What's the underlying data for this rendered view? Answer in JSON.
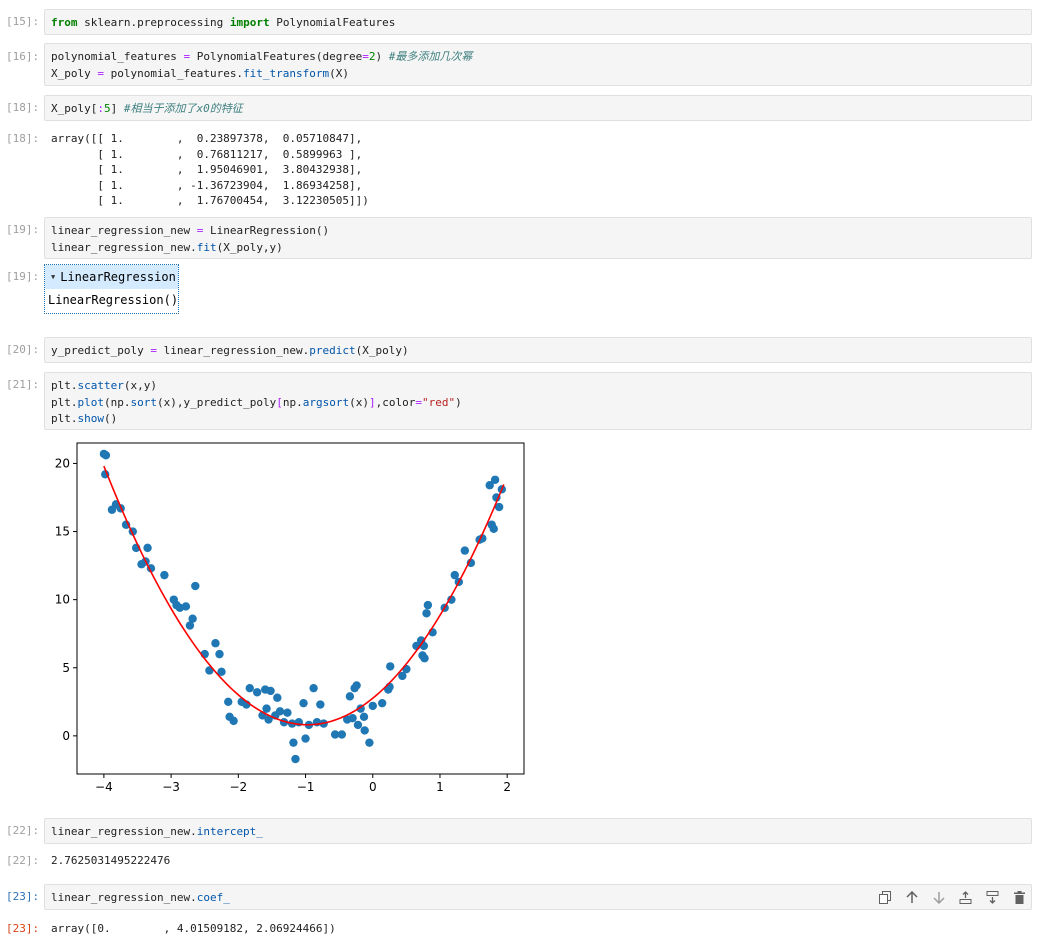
{
  "cells": {
    "c15": {
      "prompt": "[15]:"
    },
    "c16": {
      "prompt": "[16]:"
    },
    "c18": {
      "prompt": "[18]:",
      "out_prompt": "[18]:",
      "output": "array([[ 1.        ,  0.23897378,  0.05710847],\n       [ 1.        ,  0.76811217,  0.5899963 ],\n       [ 1.        ,  1.95046901,  3.80432938],\n       [ 1.        , -1.36723904,  1.86934258],\n       [ 1.        ,  1.76700454,  3.12230505]])"
    },
    "c19": {
      "prompt": "[19]:",
      "out_prompt": "[19]:",
      "estimator_header": "LinearRegression",
      "estimator_body": "LinearRegression()"
    },
    "c20": {
      "prompt": "[20]:"
    },
    "c21": {
      "prompt": "[21]:"
    },
    "c22": {
      "prompt": "[22]:",
      "out_prompt": "[22]:",
      "output": "2.7625031495222476"
    },
    "c23": {
      "prompt": "[23]:",
      "out_prompt": "[23]:",
      "output": "array([0.        , 4.01509182, 2.06924466])"
    }
  },
  "toolbar": {
    "icons": [
      "copy-icon",
      "arrow-up-icon",
      "arrow-down-icon",
      "insert-above-icon",
      "insert-below-icon",
      "trash-icon"
    ]
  },
  "chart_data": {
    "type": "scatter",
    "xlim": [
      -4.4,
      2.25
    ],
    "ylim": [
      -2.8,
      21.5
    ],
    "xticks": [
      -4,
      -3,
      -2,
      -1,
      0,
      1,
      2
    ],
    "yticks": [
      0,
      5,
      10,
      15,
      20
    ],
    "grid": false,
    "series": [
      {
        "type": "scatter",
        "color": "#1f77b4",
        "points": [
          [
            -4.0,
            20.7
          ],
          [
            -3.97,
            20.6
          ],
          [
            -3.98,
            19.2
          ],
          [
            -3.88,
            16.6
          ],
          [
            -3.82,
            17.0
          ],
          [
            -3.75,
            16.7
          ],
          [
            -3.67,
            15.5
          ],
          [
            -3.57,
            15.0
          ],
          [
            -3.52,
            13.8
          ],
          [
            -3.44,
            12.6
          ],
          [
            -3.38,
            12.8
          ],
          [
            -3.35,
            13.8
          ],
          [
            -3.3,
            12.3
          ],
          [
            -3.1,
            11.8
          ],
          [
            -2.96,
            10.0
          ],
          [
            -2.92,
            9.6
          ],
          [
            -2.87,
            9.4
          ],
          [
            -2.78,
            9.5
          ],
          [
            -2.72,
            8.1
          ],
          [
            -2.68,
            8.6
          ],
          [
            -2.64,
            11.0
          ],
          [
            -2.5,
            6.0
          ],
          [
            -2.43,
            4.8
          ],
          [
            -2.34,
            6.8
          ],
          [
            -2.28,
            6.0
          ],
          [
            -2.25,
            4.7
          ],
          [
            -2.15,
            2.5
          ],
          [
            -2.13,
            1.4
          ],
          [
            -2.07,
            1.1
          ],
          [
            -1.95,
            2.5
          ],
          [
            -1.88,
            2.3
          ],
          [
            -1.83,
            3.5
          ],
          [
            -1.72,
            3.2
          ],
          [
            -1.64,
            1.5
          ],
          [
            -1.6,
            3.4
          ],
          [
            -1.58,
            2.0
          ],
          [
            -1.55,
            1.2
          ],
          [
            -1.52,
            3.3
          ],
          [
            -1.45,
            1.5
          ],
          [
            -1.42,
            2.8
          ],
          [
            -1.38,
            1.8
          ],
          [
            -1.32,
            1.0
          ],
          [
            -1.27,
            1.7
          ],
          [
            -1.2,
            0.9
          ],
          [
            -1.18,
            -0.5
          ],
          [
            -1.15,
            -1.7
          ],
          [
            -1.1,
            1.0
          ],
          [
            -1.03,
            2.4
          ],
          [
            -1.0,
            -0.2
          ],
          [
            -0.95,
            0.8
          ],
          [
            -0.88,
            3.5
          ],
          [
            -0.83,
            1.0
          ],
          [
            -0.78,
            2.3
          ],
          [
            -0.73,
            0.9
          ],
          [
            -0.56,
            0.1
          ],
          [
            -0.46,
            0.1
          ],
          [
            -0.38,
            1.2
          ],
          [
            -0.34,
            2.9
          ],
          [
            -0.3,
            1.3
          ],
          [
            -0.27,
            3.5
          ],
          [
            -0.24,
            3.7
          ],
          [
            -0.22,
            0.8
          ],
          [
            -0.18,
            2.0
          ],
          [
            -0.13,
            1.4
          ],
          [
            -0.12,
            0.4
          ],
          [
            -0.05,
            -0.5
          ],
          [
            0.0,
            2.2
          ],
          [
            0.14,
            2.4
          ],
          [
            0.23,
            3.4
          ],
          [
            0.25,
            3.6
          ],
          [
            0.26,
            5.1
          ],
          [
            0.44,
            4.4
          ],
          [
            0.5,
            4.9
          ],
          [
            0.65,
            6.6
          ],
          [
            0.72,
            7.0
          ],
          [
            0.74,
            5.9
          ],
          [
            0.76,
            6.6
          ],
          [
            0.77,
            5.7
          ],
          [
            0.8,
            9.0
          ],
          [
            0.82,
            9.6
          ],
          [
            0.89,
            7.6
          ],
          [
            1.07,
            9.4
          ],
          [
            1.17,
            10.0
          ],
          [
            1.22,
            11.8
          ],
          [
            1.28,
            11.3
          ],
          [
            1.37,
            13.6
          ],
          [
            1.46,
            12.7
          ],
          [
            1.59,
            14.4
          ],
          [
            1.63,
            14.5
          ],
          [
            1.74,
            18.4
          ],
          [
            1.77,
            15.5
          ],
          [
            1.8,
            15.2
          ],
          [
            1.82,
            18.8
          ],
          [
            1.84,
            17.5
          ],
          [
            1.88,
            16.8
          ],
          [
            1.92,
            18.1
          ]
        ]
      },
      {
        "type": "line",
        "color": "red",
        "intercept": 2.7625031495222476,
        "coef": [
          0.0,
          4.01509182,
          2.06924466
        ],
        "x_range": [
          -4.0,
          1.95
        ]
      }
    ]
  }
}
